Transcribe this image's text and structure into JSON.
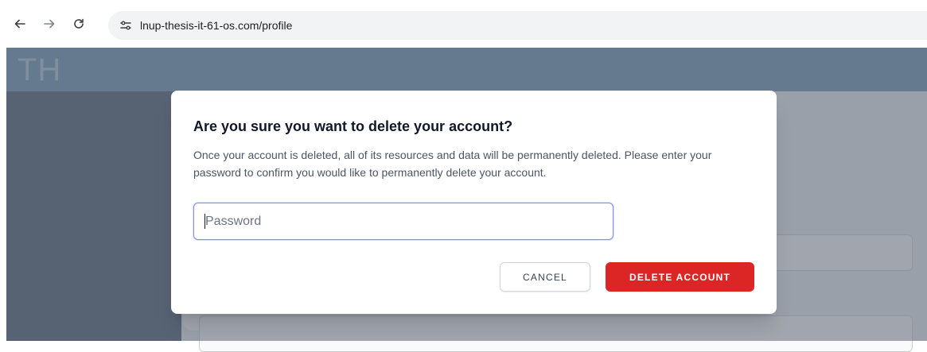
{
  "browser": {
    "url": "lnup-thesis-it-61-os.com/profile",
    "icons": [
      "back-arrow-icon",
      "forward-arrow-icon",
      "reload-icon",
      "site-settings-icon"
    ]
  },
  "app": {
    "logo": "TH"
  },
  "modal": {
    "title": "Are you sure you want to delete your account?",
    "description": "Once your account is deleted, all of its resources and data will be permanently deleted. Please enter your password to confirm you would like to permanently delete your account.",
    "password_placeholder": "Password",
    "password_value": "",
    "cancel_label": "CANCEL",
    "delete_label": "DELETE ACCOUNT"
  },
  "colors": {
    "header": "#5d84a8",
    "sidebar": "#374a5f",
    "danger": "#dc2626",
    "focus_ring": "#818cf8"
  }
}
